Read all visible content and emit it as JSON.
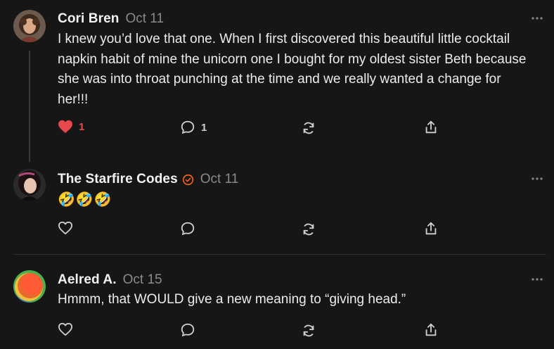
{
  "comments": [
    {
      "author": "Cori Bren",
      "date": "Oct 11",
      "text": "I knew you’d love that one. When I first discovered this beautiful little cocktail napkin habit of mine the unicorn one I bought for my oldest sister Beth because she was into throat punching at the time and we really wanted a change for her!!!",
      "likes": "1",
      "replies": "1",
      "liked": true
    },
    {
      "author": "The Starfire Codes",
      "date": "Oct 11",
      "text": "🤣🤣🤣",
      "verified": true
    },
    {
      "author": "Aelred A.",
      "date": "Oct 15",
      "text": "Hmmm, that WOULD give a new meaning to “giving head.”"
    }
  ],
  "icons": {
    "more": "more-horizontal-icon",
    "like": "heart-icon",
    "reply": "comment-bubble-icon",
    "restack": "restack-icon",
    "share": "share-icon",
    "verified": "verified-badge-icon"
  },
  "colors": {
    "background": "#161616",
    "like_active": "#e5484d",
    "verified": "#ff6719",
    "muted": "#8a8a8a"
  }
}
